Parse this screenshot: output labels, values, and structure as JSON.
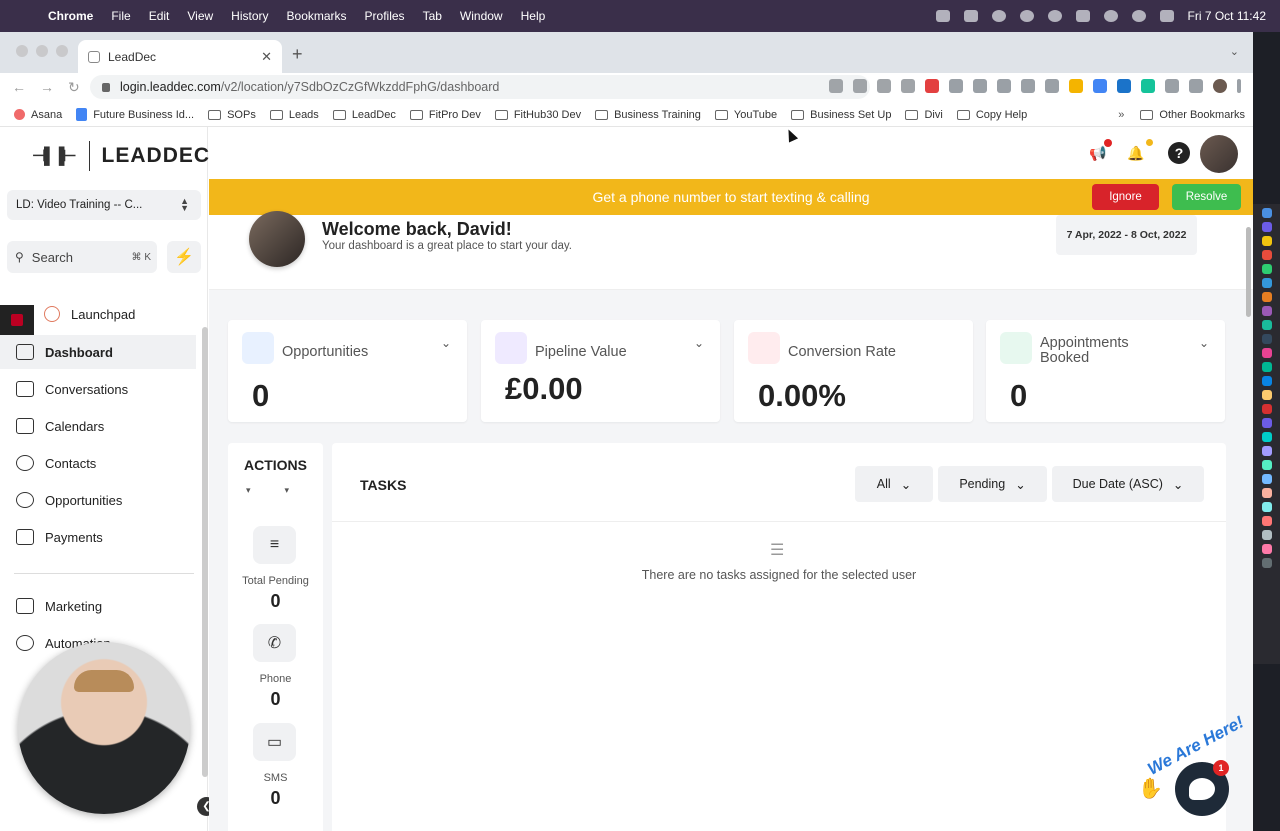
{
  "menubar": {
    "items": [
      "Chrome",
      "File",
      "Edit",
      "View",
      "History",
      "Bookmarks",
      "Profiles",
      "Tab",
      "Window",
      "Help"
    ],
    "clock": "Fri 7 Oct  11:42"
  },
  "browser": {
    "tab_title": "LeadDec",
    "url_host": "login.leaddec.com",
    "url_path": "/v2/location/y7SdbOzCzGfWkzddFphG/dashboard",
    "bookmarks": [
      "Asana",
      "Future Business Id...",
      "SOPs",
      "Leads",
      "LeadDec",
      "FitPro Dev",
      "FitHub30 Dev",
      "Business Training",
      "YouTube",
      "Business Set Up",
      "Divi",
      "Copy Help"
    ],
    "overflow": "»",
    "other_bookmarks": "Other Bookmarks"
  },
  "sidebar": {
    "logo_text": "LEADDEC",
    "location": "LD: Video Training -- C...",
    "search_label": "Search",
    "search_shortcut": "⌘ K",
    "items": [
      {
        "label": "Launchpad"
      },
      {
        "label": "Dashboard"
      },
      {
        "label": "Conversations"
      },
      {
        "label": "Calendars"
      },
      {
        "label": "Contacts"
      },
      {
        "label": "Opportunities"
      },
      {
        "label": "Payments"
      },
      {
        "label": "Marketing"
      },
      {
        "label": "Automation"
      }
    ]
  },
  "banner": {
    "text": "Get a phone number to start texting & calling",
    "ignore": "Ignore",
    "resolve": "Resolve",
    "color": "#f2b71a"
  },
  "welcome": {
    "title": "Welcome back, David!",
    "subtitle": "Your dashboard is a great place to start your day.",
    "date_range": "7 Apr, 2022 - 8 Oct, 2022"
  },
  "cards": [
    {
      "title": "Opportunities",
      "value": "0",
      "icon": "user-icon",
      "color": "#e8f1ff"
    },
    {
      "title": "Pipeline Value",
      "value": "£0.00",
      "icon": "bar-chart-icon",
      "color": "#efeaff"
    },
    {
      "title": "Conversion Rate",
      "value": "0.00%",
      "icon": "pie-chart-icon",
      "color": "#ffecee"
    },
    {
      "title": "Appointments Booked",
      "value": "0",
      "icon": "calendar-icon",
      "color": "#e7f8ef"
    }
  ],
  "actions": {
    "title": "ACTIONS",
    "items": [
      {
        "label": "Total Pending",
        "count": "0",
        "icon": "filter-icon"
      },
      {
        "label": "Phone",
        "count": "0",
        "icon": "phone-icon"
      },
      {
        "label": "SMS",
        "count": "0",
        "icon": "sms-icon"
      }
    ]
  },
  "tasks": {
    "title": "TASKS",
    "filters": [
      "All",
      "Pending",
      "Due Date (ASC)"
    ],
    "empty_text": "There are no tasks assigned for the selected user"
  },
  "chat": {
    "badge": "1",
    "tagline": "We Are Here!"
  }
}
